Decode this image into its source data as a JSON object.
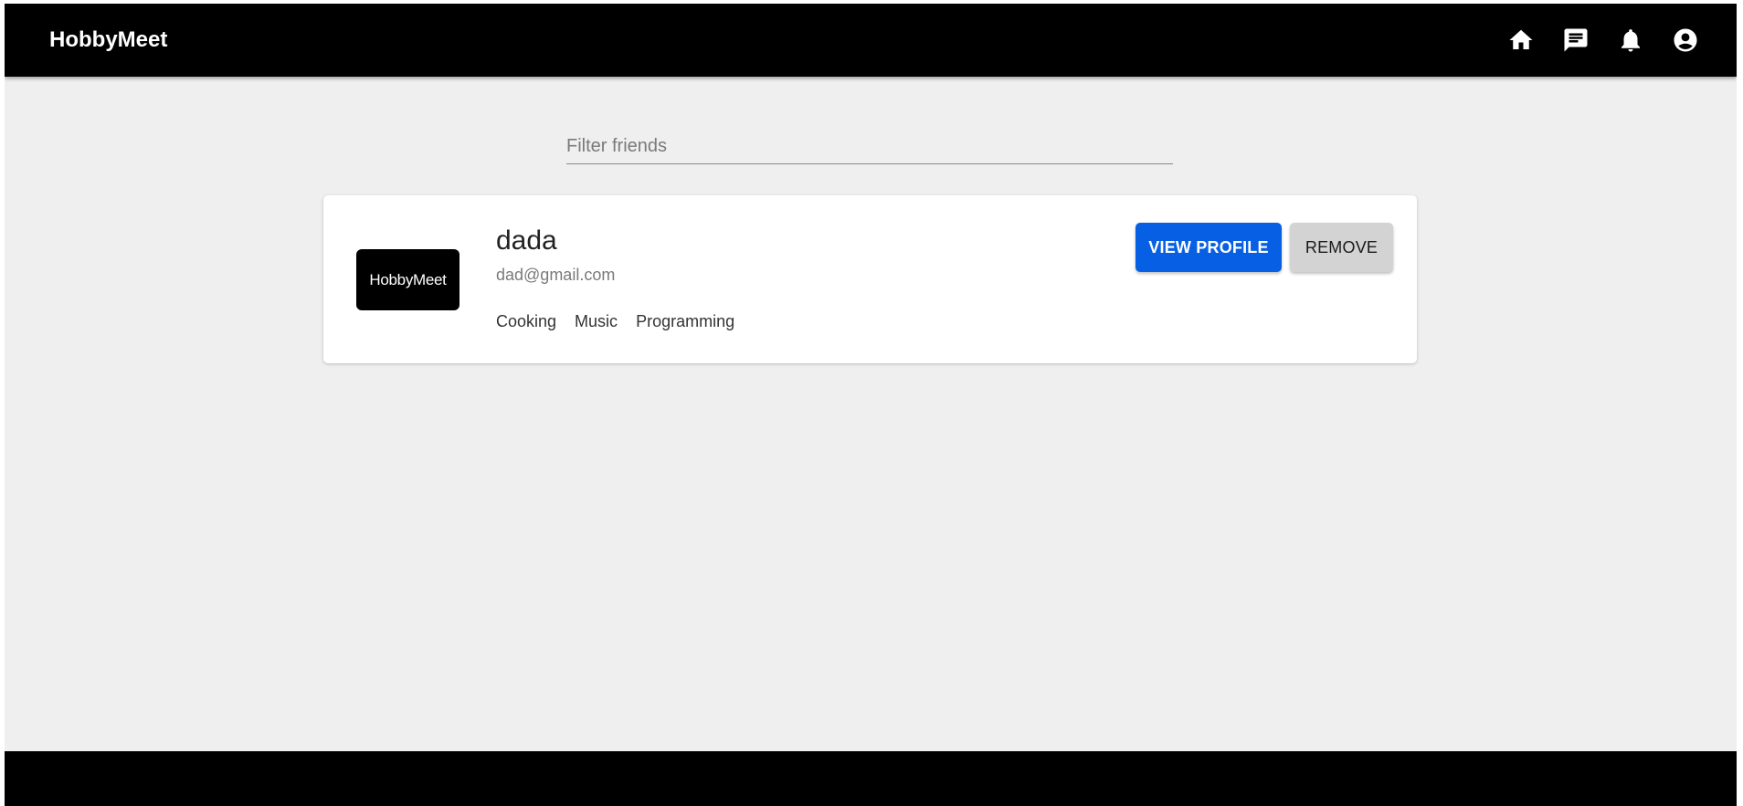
{
  "app": {
    "title": "HobbyMeet"
  },
  "nav": {
    "icons": [
      "home-icon",
      "chat-icon",
      "notifications-icon",
      "account-icon"
    ]
  },
  "filter": {
    "placeholder": "Filter friends",
    "value": ""
  },
  "friends": [
    {
      "avatar_text": "HobbyMeet",
      "name": "dada",
      "email": "dad@gmail.com",
      "hobbies": [
        "Cooking",
        "Music",
        "Programming"
      ],
      "view_label": "VIEW PROFILE",
      "remove_label": "REMOVE"
    }
  ],
  "colors": {
    "appbar": "#000000",
    "background": "#efefef",
    "primary": "#0760e4",
    "secondary_button": "#d3d3d3"
  }
}
